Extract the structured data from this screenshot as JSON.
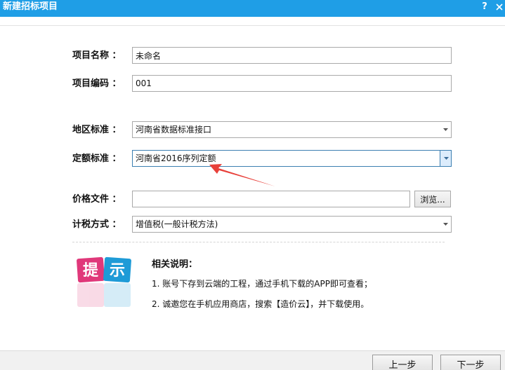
{
  "window": {
    "title": "新建招标项目",
    "help_label": "?"
  },
  "form": {
    "project_name": {
      "label": "项目名称 ：",
      "value": "未命名"
    },
    "project_code": {
      "label": "项目编码 ：",
      "value": "001"
    },
    "region_standard": {
      "label": "地区标准 ：",
      "value": "河南省数据标准接口"
    },
    "quota_standard": {
      "label": "定额标准 ：",
      "value": "河南省2016序列定额"
    },
    "price_file": {
      "label": "价格文件 ：",
      "value": "",
      "browse_label": "浏览..."
    },
    "tax_method": {
      "label": "计税方式 ：",
      "value": "增值税(一般计税方法)"
    }
  },
  "hint": {
    "icon_text": [
      "提",
      "示"
    ],
    "colors": {
      "pink": "#e0387a",
      "blue": "#1e9bd7"
    },
    "title": "相关说明：",
    "notes": [
      "1. 账号下存到云端的工程，通过手机下载的APP即可查看；",
      "2. 诚邀您在手机应用商店，搜索【造价云】，并下载使用。"
    ]
  },
  "footer": {
    "prev_label": "上一步",
    "next_label": "下一步"
  },
  "colors": {
    "title_bar": "#1f9ee6",
    "annotation_arrow": "#e8403a"
  }
}
